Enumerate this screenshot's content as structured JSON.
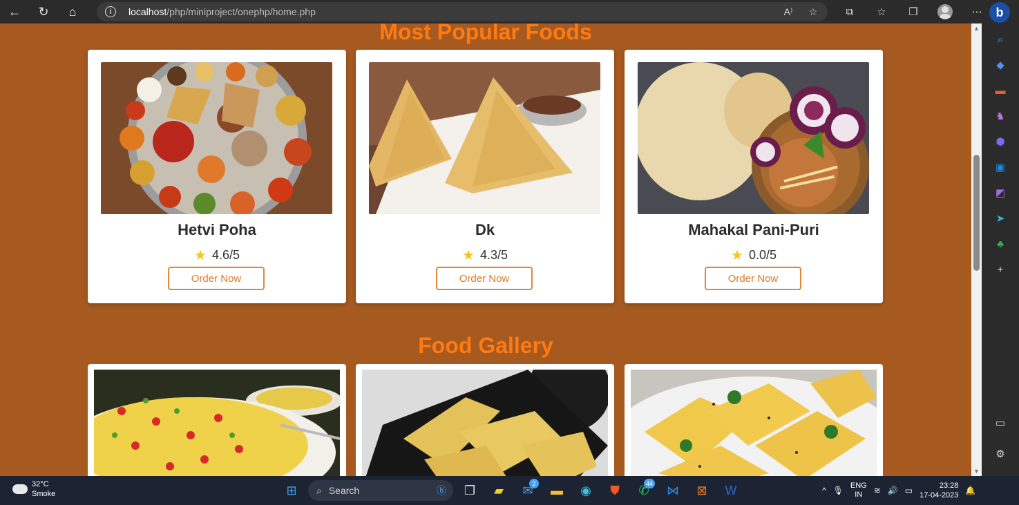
{
  "browser": {
    "url_host": "localhost",
    "url_path": "/php/miniproject/onephp/home.php"
  },
  "popular": {
    "title": "Most Popular Foods",
    "order_label": "Order Now",
    "items": [
      {
        "name": "Hetvi Poha",
        "rating": "4.6/5"
      },
      {
        "name": "Dk",
        "rating": "4.3/5"
      },
      {
        "name": "Mahakal Pani-Puri",
        "rating": "0.0/5"
      }
    ]
  },
  "gallery": {
    "title": "Food Gallery"
  },
  "taskbar": {
    "weather_temp": "32°C",
    "weather_desc": "Smoke",
    "search_label": "Search",
    "mail_badge": "2",
    "whatsapp_badge": "44",
    "lang_top": "ENG",
    "lang_bottom": "IN",
    "time": "23:28",
    "date": "17-04-2023"
  }
}
